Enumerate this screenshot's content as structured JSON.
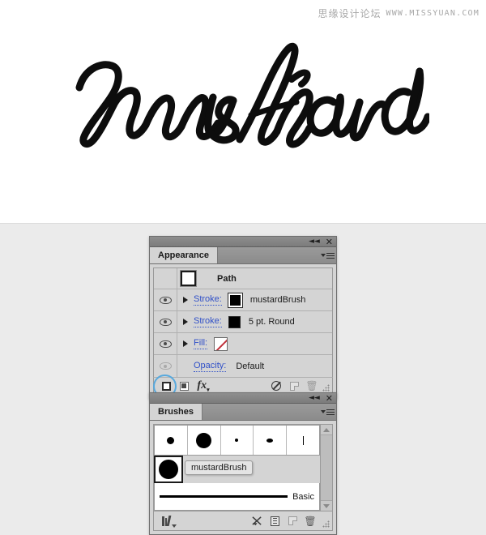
{
  "watermark": {
    "cn": "思缘设计论坛",
    "url": "WWW.MISSYUAN.COM"
  },
  "artwork": {
    "text": "mustard",
    "alt": "handwritten brush script lettering reading mustard"
  },
  "appearance": {
    "title": "Appearance",
    "titlebar": {
      "collapse_icon": "collapse-double-arrow",
      "close_icon": "close-x"
    },
    "menu_icon": "panel-menu-icon",
    "target": {
      "name": "Path",
      "thumb": "path-thumbnail"
    },
    "rows": [
      {
        "visible": true,
        "label": "Stroke:",
        "swatch": "stroke-black-selected",
        "value": "mustardBrush"
      },
      {
        "visible": true,
        "label": "Stroke:",
        "swatch": "stroke-black",
        "value": "5 pt. Round"
      },
      {
        "visible": true,
        "label": "Fill:",
        "swatch": "fill-none",
        "value": ""
      },
      {
        "visible": false,
        "label": "Opacity:",
        "swatch": "",
        "value": "Default"
      }
    ],
    "footer": [
      {
        "name": "add-new-stroke-button",
        "icon": "new-stroke-icon",
        "highlighted": true
      },
      {
        "name": "add-new-fill-button",
        "icon": "new-fill-icon",
        "highlighted": false
      },
      {
        "name": "add-new-effect-button",
        "icon": "fx-icon",
        "label": "fx",
        "highlighted": false
      },
      {
        "name": "clear-appearance-button",
        "icon": "circle-slash-icon",
        "highlighted": false
      },
      {
        "name": "duplicate-item-button",
        "icon": "duplicate-page-icon",
        "highlighted": false
      },
      {
        "name": "delete-item-button",
        "icon": "trash-icon",
        "highlighted": false
      }
    ]
  },
  "brushes": {
    "title": "Brushes",
    "titlebar": {
      "collapse_icon": "collapse-double-arrow",
      "close_icon": "close-x"
    },
    "menu_icon": "panel-menu-icon",
    "grid": [
      {
        "name": "brush-dot-small",
        "shape": "dot",
        "w": 9,
        "h": 9
      },
      {
        "name": "brush-dot-large",
        "shape": "dot",
        "w": 19,
        "h": 19
      },
      {
        "name": "brush-dot-tiny",
        "shape": "dot",
        "w": 4,
        "h": 4
      },
      {
        "name": "brush-oval-small",
        "shape": "oval",
        "w": 8,
        "h": 5
      },
      {
        "name": "brush-line-thin",
        "shape": "line",
        "w": 1,
        "h": 11
      }
    ],
    "selected_brush": {
      "name": "mustardBrush",
      "thumb": "brush-dot-xl",
      "selected": true
    },
    "tooltip": "mustardBrush",
    "basic_brush": {
      "label": "Basic"
    },
    "scrollbar": {
      "up_icon": "scroll-up-arrow",
      "down_icon": "scroll-down-arrow"
    },
    "footer": [
      {
        "name": "brush-libraries-menu-button",
        "icon": "brush-libraries-icon"
      },
      {
        "name": "remove-brush-stroke-button",
        "icon": "remove-brush-stroke-icon"
      },
      {
        "name": "brush-options-button",
        "icon": "brush-options-icon"
      },
      {
        "name": "new-brush-button",
        "icon": "new-brush-icon"
      },
      {
        "name": "delete-brush-button",
        "icon": "trash-icon"
      }
    ]
  }
}
